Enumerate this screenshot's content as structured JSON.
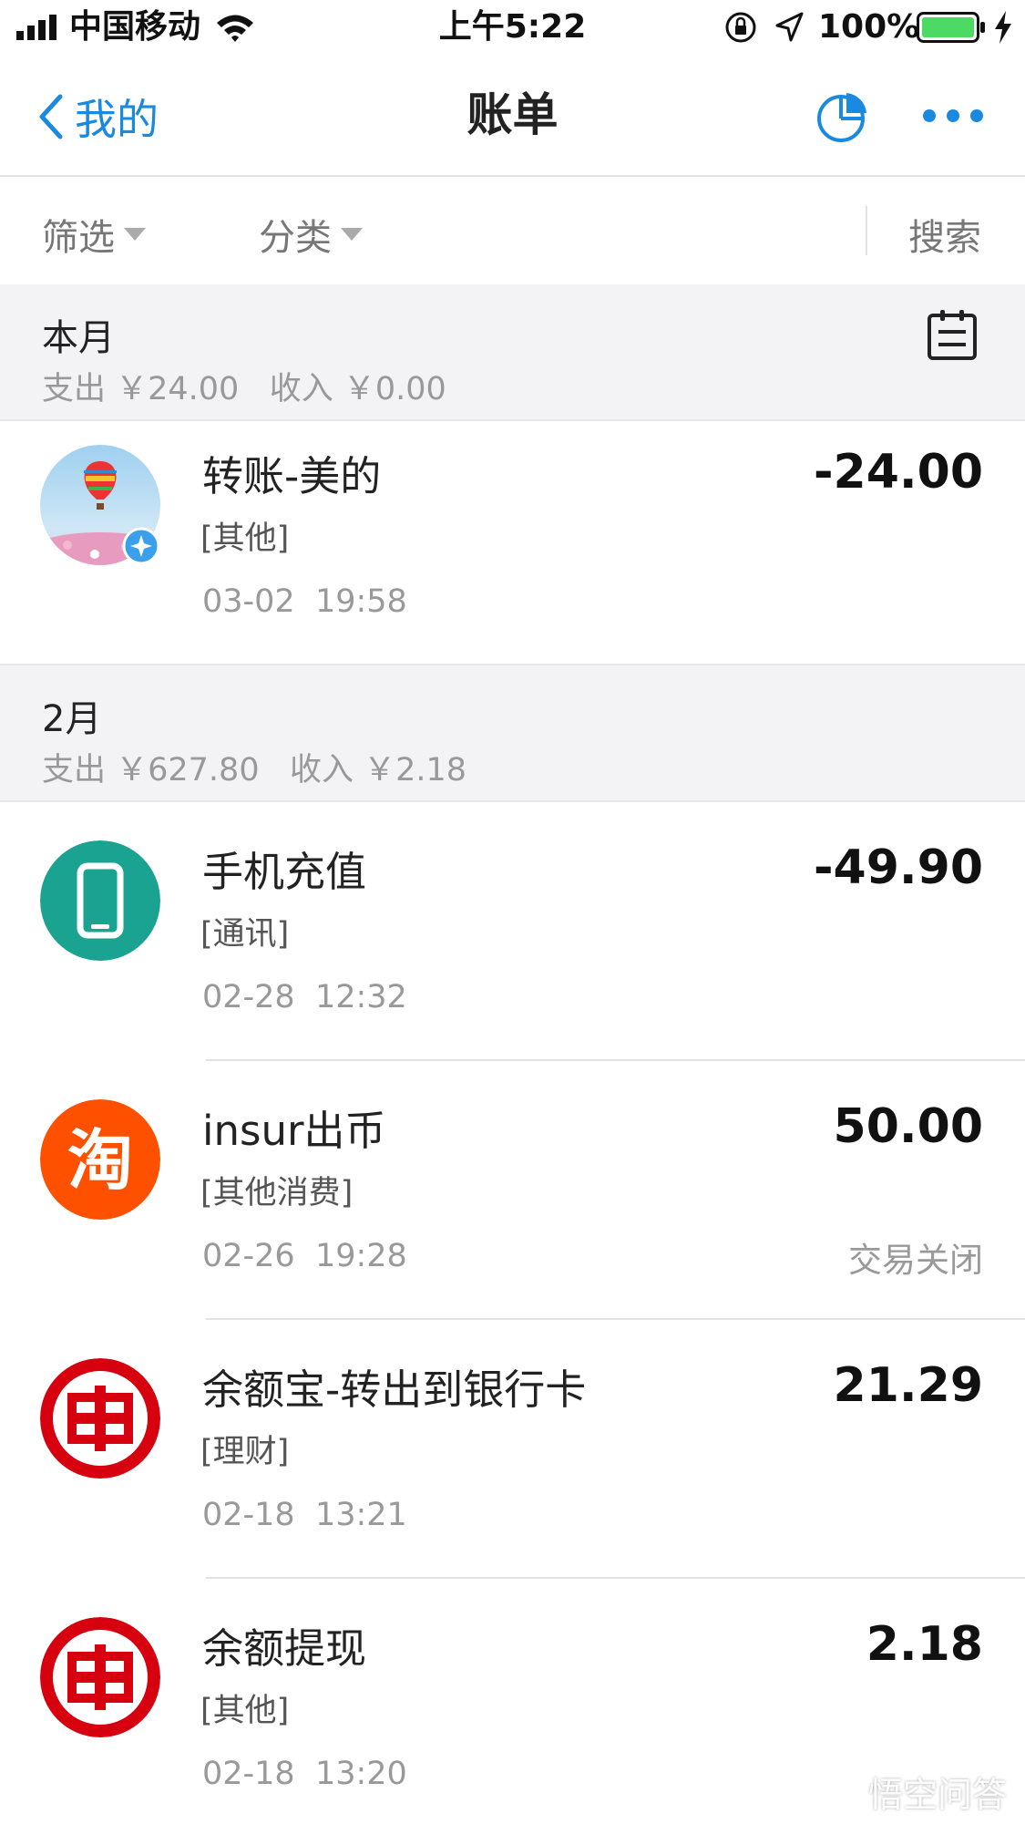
{
  "status_bar": {
    "carrier": "中国移动",
    "time": "上午5:22",
    "battery": "100%"
  },
  "nav": {
    "back_label": "我的",
    "title": "账单"
  },
  "filters": {
    "filter_label": "筛选",
    "category_label": "分类",
    "search_label": "搜索"
  },
  "months": [
    {
      "title": "本月",
      "summary": "支出 ￥24.00   收入 ￥0.00",
      "bills": [
        {
          "name": "转账-美的",
          "category": "[其他]",
          "date": "03-02  19:58",
          "amount": "-24.00",
          "icon": "hot-air-balloon-avatar",
          "status": ""
        }
      ]
    },
    {
      "title": "2月",
      "summary": "支出 ￥627.80   收入 ￥2.18",
      "bills": [
        {
          "name": "手机充值",
          "category": "[通讯]",
          "date": "02-28  12:32",
          "amount": "-49.90",
          "icon": "mobile-phone-icon",
          "status": ""
        },
        {
          "name": "insur出币",
          "category": "[其他消费]",
          "date": "02-26  19:28",
          "amount": "50.00",
          "icon": "taobao-icon",
          "status": "交易关闭"
        },
        {
          "name": "余额宝-转出到银行卡",
          "category": "[理财]",
          "date": "02-18  13:21",
          "amount": "21.29",
          "icon": "icbc-bank-icon",
          "status": ""
        },
        {
          "name": "余额提现",
          "category": "[其他]",
          "date": "02-18  13:20",
          "amount": "2.18",
          "icon": "icbc-bank-icon",
          "status": ""
        }
      ]
    }
  ],
  "watermark": "悟空问答",
  "colors": {
    "accent": "#1a8ae0",
    "teal": "#1aa391",
    "taobao": "#ff5000",
    "icbc": "#d7000f",
    "section_bg": "#f3f3f5"
  }
}
